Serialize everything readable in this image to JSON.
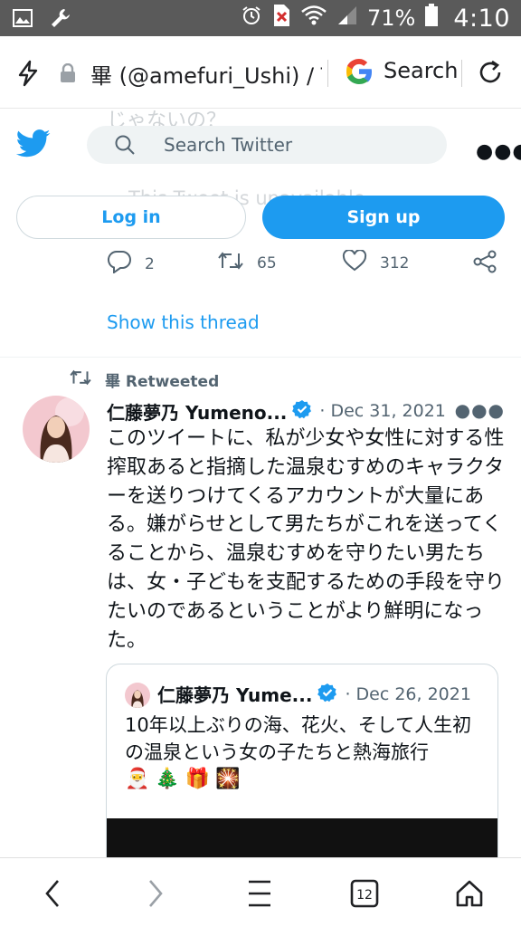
{
  "status_bar": {
    "battery": "71%",
    "time": "4:10",
    "icons": [
      "image-icon",
      "wrench-icon",
      "alarm-icon",
      "no-sim-icon",
      "wifi-icon",
      "signal-icon",
      "battery-icon"
    ]
  },
  "browser": {
    "url": "畢 (@amefuri_Ushi) / Twitter",
    "search_label": "Search",
    "icons": [
      "bolt-icon",
      "lock-icon",
      "google-logo",
      "reload-icon"
    ]
  },
  "twitter": {
    "faded_top_text": "じゃないの？",
    "faded_unavailable": "This Tweet is unavailable.",
    "search_placeholder": "Search Twitter",
    "login_label": "Log in",
    "signup_label": "Sign up",
    "brand_color": "#1d9bf0"
  },
  "prev_tweet_actions": {
    "replies": "2",
    "retweets": "65",
    "likes": "312"
  },
  "show_thread": "Show this thread",
  "retweet_banner": {
    "text": "畢 Retweeted"
  },
  "tweet": {
    "author": "仁藤夢乃 Yumeno...",
    "date": "· Dec 31, 2021",
    "text": "このツイートに、私が少女や女性に対する性搾取あると指摘した温泉むすめのキャラクターを送りつけてくるアカウントが大量にある。嫌がらせとして男たちがこれを送ってくることから、温泉むすめを守りたい男たちは、女・子どもを支配するための手段を守りたいのであるということがより鮮明になった。"
  },
  "quote": {
    "author": "仁藤夢乃 Yume...",
    "date": "· Dec 26, 2021",
    "text": "10年以上ぶりの海、花火、そして人生初の温泉という女の子たちと熱海旅行",
    "emojis": [
      "🎅",
      "🎄",
      "🎁",
      "🎇"
    ]
  },
  "bottom_nav": {
    "tab_count": "12",
    "icons": [
      "back-icon",
      "forward-icon",
      "menu-icon",
      "tabs-icon",
      "home-icon"
    ]
  }
}
